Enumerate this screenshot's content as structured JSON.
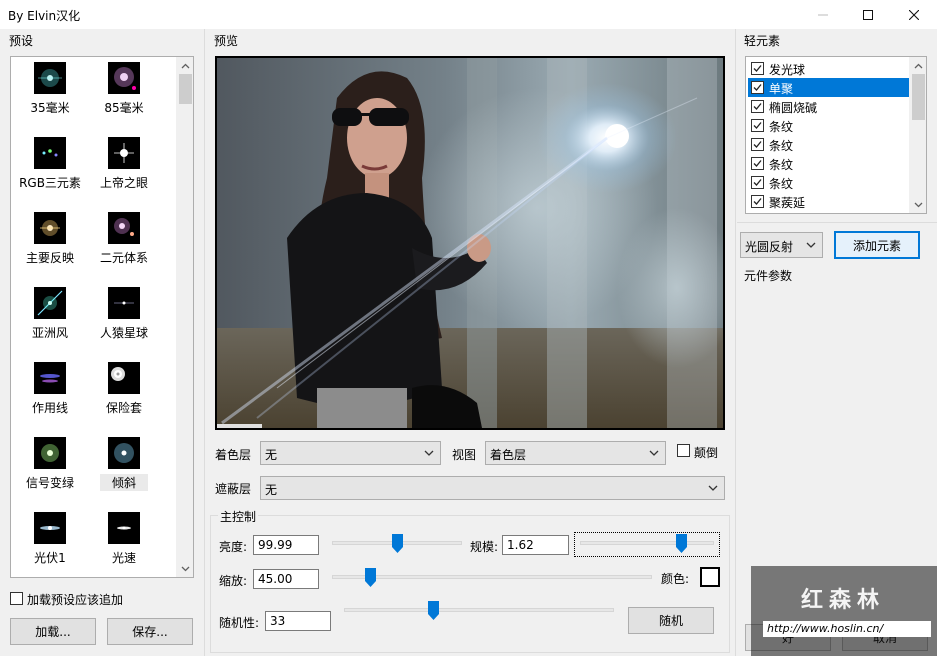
{
  "window": {
    "title": "By Elvin汉化",
    "minimize_icon": "minimize-icon",
    "maximize_icon": "maximize-icon",
    "close_icon": "close-icon"
  },
  "presets_panel": {
    "label": "预设",
    "items": [
      {
        "label": "35毫米"
      },
      {
        "label": "85毫米"
      },
      {
        "label": "RGB三元素"
      },
      {
        "label": "上帝之眼"
      },
      {
        "label": "主要反映"
      },
      {
        "label": "二元体系"
      },
      {
        "label": "亚洲风"
      },
      {
        "label": "人猿星球"
      },
      {
        "label": "作用线"
      },
      {
        "label": "保险套"
      },
      {
        "label": "信号变绿"
      },
      {
        "label": "倾斜"
      },
      {
        "label": "光伏1"
      },
      {
        "label": "光速"
      }
    ],
    "append_checkbox_label": "加载预设应该追加",
    "append_checked": false,
    "load_button": "加载...",
    "save_button": "保存..."
  },
  "preview_panel": {
    "label": "预览"
  },
  "layer_controls": {
    "color_layer_label": "着色层",
    "color_layer_value": "无",
    "view_label": "视图",
    "view_value": "着色层",
    "invert_label": "颠倒",
    "invert_checked": false,
    "mask_layer_label": "遮蔽层",
    "mask_layer_value": "无"
  },
  "main_control": {
    "label": "主控制",
    "brightness_label": "亮度:",
    "brightness_value": "99.99",
    "brightness_level": 0.5,
    "scale_label": "规模:",
    "scale_value": "1.62",
    "scale_level": 0.75,
    "zoom_label": "缩放:",
    "zoom_value": "45.00",
    "zoom_level": 0.12,
    "color_label": "颜色:",
    "color_value": "#ffffff",
    "randomness_label": "随机性:",
    "randomness_value": "33",
    "randomness_level": 0.33,
    "random_button": "随机"
  },
  "elements_panel": {
    "label": "轻元素",
    "items": [
      {
        "label": "发光球",
        "checked": true,
        "selected": false
      },
      {
        "label": "单聚",
        "checked": true,
        "selected": true
      },
      {
        "label": "椭圆烧碱",
        "checked": true,
        "selected": false
      },
      {
        "label": "条纹",
        "checked": true,
        "selected": false
      },
      {
        "label": "条纹",
        "checked": true,
        "selected": false
      },
      {
        "label": "条纹",
        "checked": true,
        "selected": false
      },
      {
        "label": "条纹",
        "checked": true,
        "selected": false
      },
      {
        "label": "聚蒺延",
        "checked": true,
        "selected": false
      }
    ],
    "type_select_value": "光圆反射",
    "add_button": "添加元素",
    "params_label": "元件参数",
    "ok_button": "好",
    "cancel_button": "取消"
  },
  "watermark": {
    "title": "红森林",
    "url": "http://www.hoslin.cn/"
  },
  "colors": {
    "accent": "#0078d7",
    "window_bg": "#f0f0f0",
    "list_bg": "#ffffff"
  }
}
